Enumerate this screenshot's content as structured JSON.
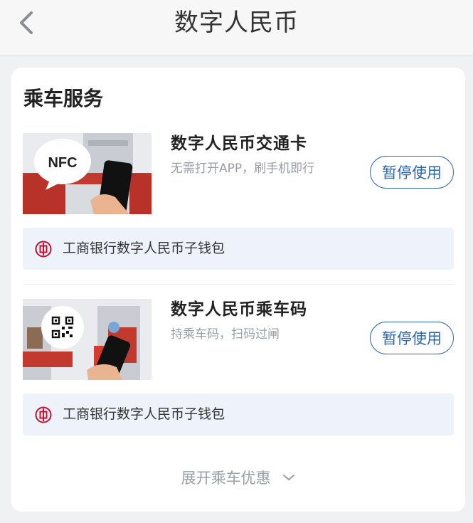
{
  "header": {
    "title": "数字人民币",
    "back_icon": "chevron-left-icon"
  },
  "card": {
    "section_title": "乘车服务",
    "services": [
      {
        "name": "数字人民币交通卡",
        "description": "无需打开APP，刷手机即行",
        "button_label": "暂停使用",
        "badge_text": "NFC",
        "wallet_label": "工商银行数字人民币子钱包"
      },
      {
        "name": "数字人民币乘车码",
        "description": "持乘车码，扫码过闸",
        "button_label": "暂停使用",
        "badge_icon": "qr-code-icon",
        "wallet_label": "工商银行数字人民币子钱包"
      }
    ],
    "expand_label": "展开乘车优惠"
  },
  "colors": {
    "accent": "#2a67b3",
    "bank_red": "#c8102e",
    "wallet_bg": "#eef3fb",
    "muted_text": "#9a9ea6"
  }
}
